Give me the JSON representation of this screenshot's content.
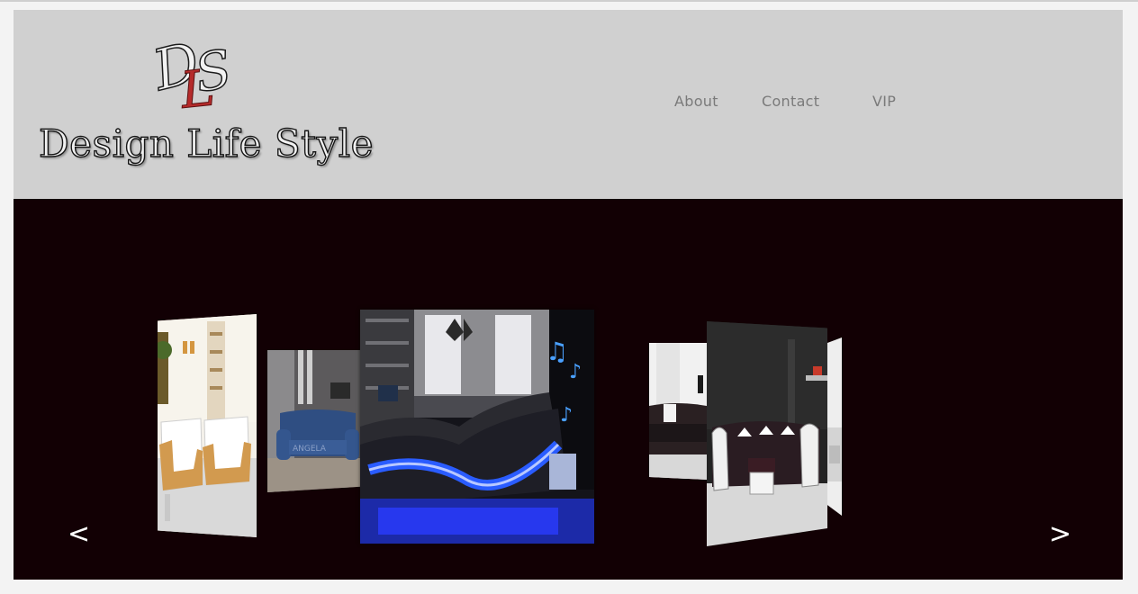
{
  "header": {
    "logo": {
      "monogram": "DLS",
      "text": "Design Life Style"
    },
    "nav": [
      {
        "label": "About"
      },
      {
        "label": "Contact"
      },
      {
        "label": "VIP"
      }
    ]
  },
  "carousel": {
    "prev_label": "<",
    "next_label": ">",
    "slides": [
      {
        "subject": "living room with white and tan armchairs"
      },
      {
        "subject": "blue upholstered loveseat"
      },
      {
        "subject": "black bed with blue LED lighting and music notes"
      },
      {
        "subject": "black leather sofa"
      },
      {
        "subject": "black and white sectional sofa set"
      },
      {
        "subject": "white interior with red accent shelf"
      }
    ]
  },
  "colors": {
    "header_bg": "#d0d0d0",
    "stage_bg": "#120004",
    "nav_text": "#7a7a7a",
    "led_blue": "#2a3cff"
  }
}
